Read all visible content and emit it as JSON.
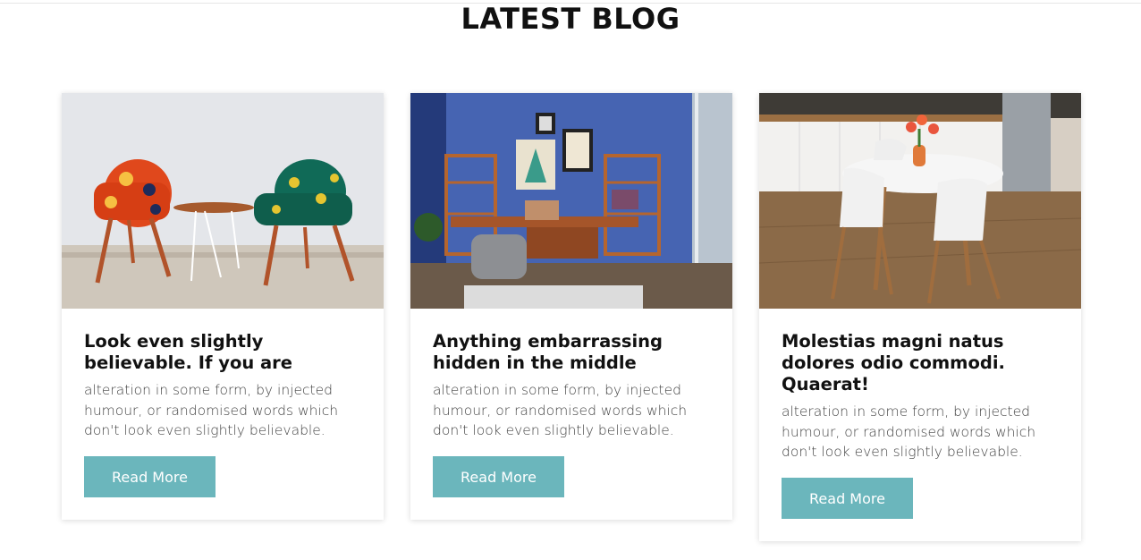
{
  "section": {
    "title": "LATEST BLOG"
  },
  "posts": [
    {
      "title": "Look even slightly believable. If you are",
      "excerpt": "alteration in some form, by injected humour, or randomised words which don't look even slightly believable.",
      "button": "Read More",
      "image_icon": "chairs-photo"
    },
    {
      "title": "Anything embarrassing hidden in the middle",
      "excerpt": "alteration in some form, by injected humour, or randomised words which don't look even slightly believable.",
      "button": "Read More",
      "image_icon": "office-room-photo"
    },
    {
      "title": "Molestias magni natus dolores odio commodi. Quaerat!",
      "excerpt": "alteration in some form, by injected humour, or randomised words which don't look even slightly believable.",
      "button": "Read More",
      "image_icon": "dining-kitchen-photo"
    }
  ],
  "colors": {
    "button_bg": "#6bb6bc",
    "button_text": "#ffffff",
    "title": "#111111",
    "text": "#444444"
  }
}
